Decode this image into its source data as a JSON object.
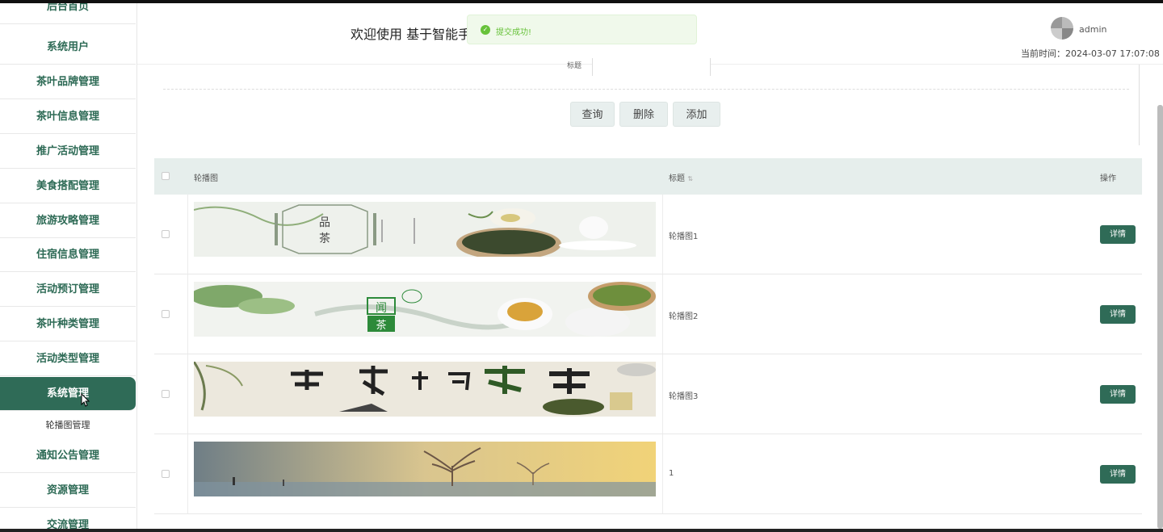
{
  "sidebar": {
    "items": [
      {
        "label": "后台首页"
      },
      {
        "label": "系统用户"
      },
      {
        "label": "茶叶品牌管理"
      },
      {
        "label": "茶叶信息管理"
      },
      {
        "label": "推广活动管理"
      },
      {
        "label": "美食搭配管理"
      },
      {
        "label": "旅游攻略管理"
      },
      {
        "label": "住宿信息管理"
      },
      {
        "label": "活动预订管理"
      },
      {
        "label": "茶叶种类管理"
      },
      {
        "label": "活动类型管理"
      },
      {
        "label": "系统管理"
      },
      {
        "label": "通知公告管理"
      },
      {
        "label": "资源管理"
      },
      {
        "label": "交流管理"
      }
    ],
    "submenu": {
      "label": "轮播图管理"
    },
    "active_color": "#2f6b57"
  },
  "header": {
    "welcome": "欢迎使用 基于智能手",
    "username": "admin",
    "current_time": "当前时间：2024-03-07 17:07:08"
  },
  "toast": {
    "text": "提交成功!",
    "icon": "success-check-icon"
  },
  "search": {
    "label": "标题"
  },
  "buttons": {
    "query": "查询",
    "delete": "删除",
    "add": "添加"
  },
  "table": {
    "headers": {
      "image": "轮播图",
      "title": "标题",
      "action": "操作"
    },
    "rows": [
      {
        "title": "轮播图1",
        "detail": "详情"
      },
      {
        "title": "轮播图2",
        "detail": "详情"
      },
      {
        "title": "轮播图3",
        "detail": "详情"
      },
      {
        "title": "1",
        "detail": "详情"
      }
    ]
  },
  "colors": {
    "accent": "#2f6b57",
    "header_bg": "#e6eeec",
    "toast_green": "#67c23a"
  }
}
